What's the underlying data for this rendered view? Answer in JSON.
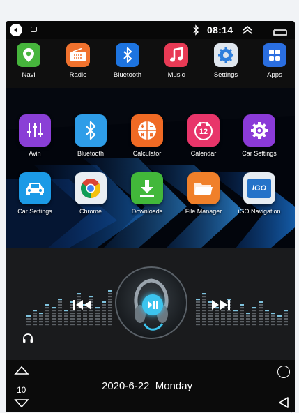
{
  "status_bar": {
    "time": "08:14",
    "icons": [
      "back-icon",
      "notification-icon",
      "bluetooth-icon",
      "expand-icon",
      "window-icon"
    ]
  },
  "dock": [
    {
      "label": "Navi",
      "icon": "map-pin-icon",
      "color": "#46b53c"
    },
    {
      "label": "Radio",
      "icon": "radio-icon",
      "color": "#f0722e"
    },
    {
      "label": "Bluetooth",
      "icon": "bluetooth-icon",
      "color": "#1d74e0"
    },
    {
      "label": "Music",
      "icon": "music-note-icon",
      "color": "#e83a55"
    },
    {
      "label": "Settings",
      "icon": "gear-icon",
      "color": "#dfe6ee"
    },
    {
      "label": "Apps",
      "icon": "grid-icon",
      "color": "#2a6ee0"
    }
  ],
  "apps": [
    {
      "label": "Avin",
      "icon": "equalizer-icon",
      "color": "#8a3fd6"
    },
    {
      "label": "Bluetooth",
      "icon": "bluetooth-icon",
      "color": "#2e9de8"
    },
    {
      "label": "Calculator",
      "icon": "calculator-icon",
      "color": "#f06a24"
    },
    {
      "label": "Calendar",
      "icon": "calendar-icon",
      "color": "#e8356a"
    },
    {
      "label": "Car Settings",
      "icon": "gear-icon",
      "color": "#8b3ad8"
    },
    {
      "label": "Car Settings",
      "icon": "car-icon",
      "color": "#1b9ae6"
    },
    {
      "label": "Chrome",
      "icon": "chrome-icon",
      "color": "#e9eef3"
    },
    {
      "label": "Downloads",
      "icon": "download-icon",
      "color": "#42b83a"
    },
    {
      "label": "File Manager",
      "icon": "folder-icon",
      "color": "#f0802a"
    },
    {
      "label": "iGO Navigation",
      "icon": "igo-icon",
      "color": "#e6ecf2"
    }
  ],
  "calendar_day": "12",
  "igo_logo": "iGO",
  "music": {
    "controls": [
      "previous-icon",
      "play-pause-icon",
      "next-icon",
      "headphones-icon"
    ]
  },
  "bottom_bar": {
    "volume": "10",
    "date": "2020-6-22",
    "weekday": "Monday",
    "date_line": "2020-6-22  Monday"
  }
}
